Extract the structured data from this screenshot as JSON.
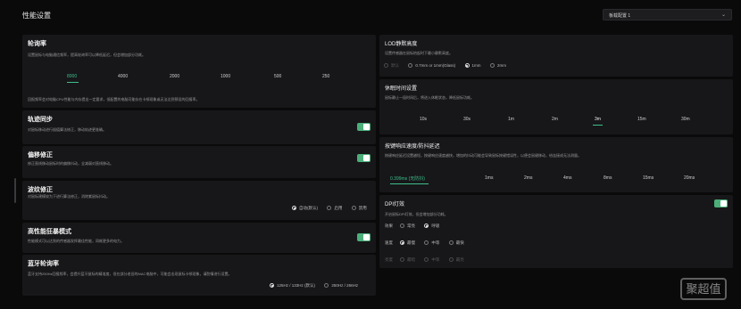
{
  "header": {
    "title": "性能设置",
    "profile": "板载配置 1",
    "profile_chevron": "chevron-down-icon"
  },
  "polling": {
    "title": "轮询率",
    "desc": "设置鼠标与电脑通信频率，提高轮询率可以降低延迟，但会增加部分功耗。",
    "options": [
      "8000",
      "4000",
      "2000",
      "1000",
      "500",
      "250"
    ],
    "selected": "8000",
    "note": "回报频率会对电脑CPU性能与内存提出一定要求，低配置的电脑可能存在卡顿现象或无法达到预设的回报率。"
  },
  "track_sync": {
    "title": "轨迹同步",
    "desc": "对鼠标移动进行插值算法修正，移动轨迹更准确。",
    "enabled": true
  },
  "offset_fix": {
    "title": "偏移修正",
    "desc": "修正直线移动鼠标时的偏移抖动，全减弱对直线移动。",
    "enabled": true
  },
  "ripple": {
    "title": "波纹修正",
    "desc": "对鼠标建模较为下进行算法修正，消除紫鼠标抖动。",
    "options": [
      "自动(默认)",
      "启用",
      "禁用"
    ],
    "selected": "自动(默认)"
  },
  "extreme": {
    "title": "高性能狂暴模式",
    "desc": "性能模式可以达到的传感器发挥最佳性能，同耗更多的电力。",
    "enabled": true
  },
  "bluetooth": {
    "title": "蓝牙轮询率",
    "desc": "蓝牙支持250Hz回报频率，会提升蓝牙鼠标的精准度，但在部分老旧的MAC电脑中，可能会出现鼠标卡顿现象，请酌情进行设置。",
    "options": [
      "125Hz / 133Hz (默认)",
      "250Hz / 266Hz"
    ],
    "selected": "125Hz / 133Hz (默认)"
  },
  "lod": {
    "title": "LOD静默高度",
    "desc": "设置传感器在鼠标抬起时下最小静默高度。",
    "options": [
      "默认",
      "0.7mm or 1mm(Glass)",
      "1mm",
      "2mm"
    ],
    "selected": "1mm"
  },
  "sleep": {
    "title": "休眠时间设置",
    "desc": "鼠标静止一段时间后，将进入休眠状态，降低鼠标功耗。",
    "options": [
      "10s",
      "30s",
      "1m",
      "2m",
      "3m",
      "15m",
      "30m"
    ],
    "selected": "3m"
  },
  "debounce": {
    "title": "按键响应速度/防抖延迟",
    "desc": "按键响应延迟设置越短，按键响应速度越快，增加的抖动可能会导致鼠标按键错误性，以便会鼠键移动，给连接成无法测量。",
    "options": [
      "0.399ms (无防抖)",
      "1ms",
      "2ms",
      "4ms",
      "8ms",
      "15ms",
      "20ms"
    ],
    "selected": "0.399ms (无防抖)"
  },
  "dpi_light": {
    "title": "DPI灯效",
    "desc": "开启鼠标DPI灯效，但会增加部分功耗。",
    "enabled": true,
    "effect": {
      "label": "效果",
      "options": [
        "常亮",
        "呼吸"
      ],
      "selected": "呼吸"
    },
    "speed": {
      "label": "速度",
      "options": [
        "最慢",
        "中等",
        "最快"
      ],
      "selected": "最慢"
    },
    "brightness": {
      "label": "亮度",
      "options": [
        "最暗",
        "中等",
        "最亮"
      ],
      "selected": "最暗",
      "disabled": true
    }
  },
  "watermark": "聚超值"
}
